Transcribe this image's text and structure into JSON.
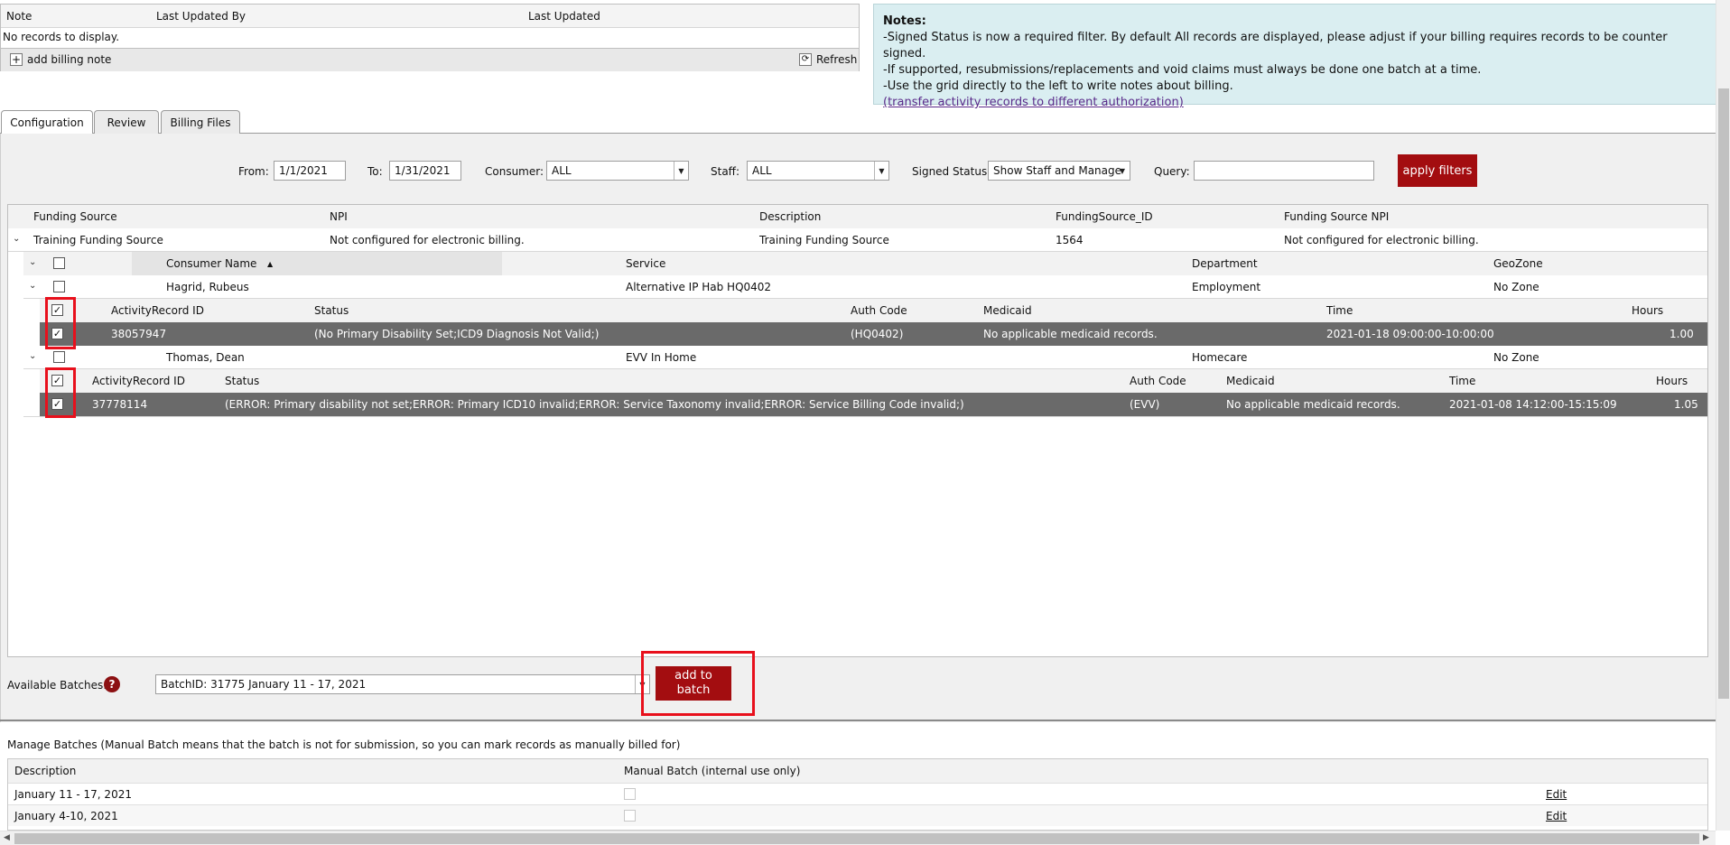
{
  "notes_grid": {
    "columns": [
      "Note",
      "Last Updated By",
      "Last Updated"
    ],
    "empty_text": "No records to display.",
    "add_label": "add billing note",
    "refresh_label": "Refresh"
  },
  "notes_panel": {
    "title": "Notes:",
    "lines": [
      "-Signed Status is now a required filter. By default All records are displayed, please adjust if your billing requires records to be counter signed.",
      "-If supported, resubmissions/replacements and void claims must always be done one batch at a time.",
      "-Use the grid directly to the left to write notes about billing."
    ],
    "link": "(transfer activity records to different authorization)"
  },
  "tabs": [
    "Configuration",
    "Review",
    "Billing Files"
  ],
  "filters": {
    "from_label": "From:",
    "from_value": "1/1/2021",
    "to_label": "To:",
    "to_value": "1/31/2021",
    "consumer_label": "Consumer:",
    "consumer_value": "ALL",
    "staff_label": "Staff:",
    "staff_value": "ALL",
    "signed_label": "Signed Status:",
    "signed_value": "Show Staff and Manage",
    "query_label": "Query:",
    "query_value": "",
    "apply_label": "apply filters"
  },
  "funding": {
    "columns": [
      "Funding Source",
      "NPI",
      "Description",
      "FundingSource_ID",
      "Funding Source NPI"
    ],
    "row": [
      "Training Funding Source",
      "Not configured for electronic billing.",
      "Training Funding Source",
      "1564",
      "Not configured for electronic billing."
    ]
  },
  "consumers": {
    "columns": [
      "Consumer Name",
      "Service",
      "Department",
      "GeoZone"
    ],
    "sort_indicator": "▲",
    "items": [
      {
        "values": [
          "Hagrid, Rubeus",
          "Alternative IP Hab HQ0402",
          "Employment",
          "No Zone"
        ],
        "record_columns": [
          "ActivityRecord ID",
          "Status",
          "Auth Code",
          "Medicaid",
          "Time",
          "Hours"
        ],
        "record": [
          "38057947",
          "(No Primary Disability Set;ICD9 Diagnosis Not Valid;)",
          "(HQ0402)",
          "No applicable medicaid records.",
          "2021-01-18 09:00:00-10:00:00",
          "1.00"
        ]
      },
      {
        "values": [
          "Thomas, Dean",
          "EVV In Home",
          "Homecare",
          "No Zone"
        ],
        "record_columns": [
          "ActivityRecord ID",
          "Status",
          "Auth Code",
          "Medicaid",
          "Time",
          "Hours"
        ],
        "record": [
          "37778114",
          "(ERROR: Primary disability not set;ERROR: Primary ICD10 invalid;ERROR: Service Taxonomy invalid;ERROR: Service Billing Code invalid;)",
          "(EVV)",
          "No applicable medicaid records.",
          "2021-01-08 14:12:00-15:15:09",
          "1.05"
        ]
      }
    ]
  },
  "batches": {
    "label": "Available Batches:",
    "help": "?",
    "selected": "BatchID: 31775 January 11 - 17, 2021",
    "add_label_1": "add to",
    "add_label_2": "batch"
  },
  "manage": {
    "title": "Manage Batches (Manual Batch means that the batch is not for submission, so you can mark records as manually billed for)",
    "columns": [
      "Description",
      "Manual Batch (internal use only)"
    ],
    "rows": [
      {
        "description": "January 11 - 17, 2021",
        "edit": "Edit"
      },
      {
        "description": "January 4-10, 2021",
        "edit": "Edit"
      }
    ]
  },
  "colors": {
    "accent_red": "#a30d10",
    "notes_bg": "#daeef1",
    "highlight_red": "#e8101c",
    "selected_row": "#6a6a6a"
  }
}
